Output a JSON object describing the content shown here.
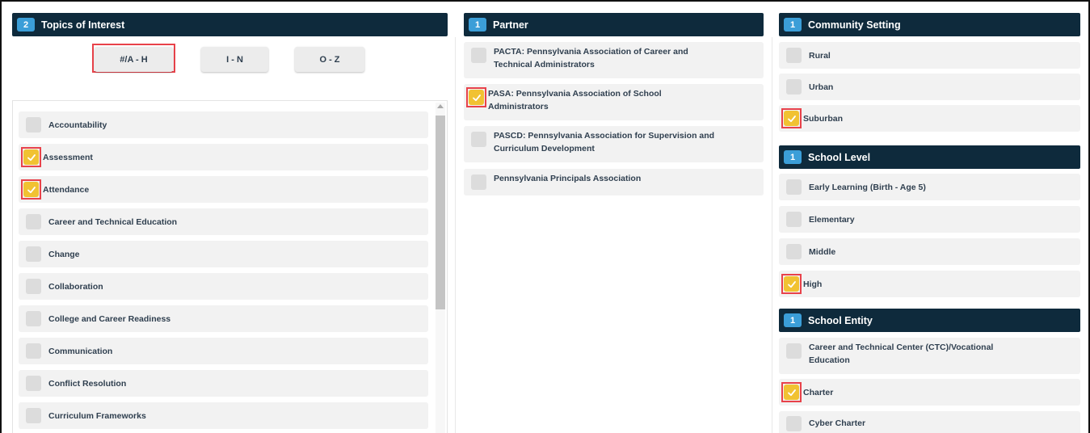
{
  "topics": {
    "count": "2",
    "title": "Topics of Interest",
    "filters": [
      "#/A - H",
      "I - N",
      "O - Z"
    ],
    "items": [
      {
        "label": "Accountability",
        "checked": false
      },
      {
        "label": "Assessment",
        "checked": true
      },
      {
        "label": "Attendance",
        "checked": true
      },
      {
        "label": "Career and Technical Education",
        "checked": false
      },
      {
        "label": "Change",
        "checked": false
      },
      {
        "label": "Collaboration",
        "checked": false
      },
      {
        "label": "College and Career Readiness",
        "checked": false
      },
      {
        "label": "Communication",
        "checked": false
      },
      {
        "label": "Conflict Resolution",
        "checked": false
      },
      {
        "label": "Curriculum Frameworks",
        "checked": false
      }
    ]
  },
  "partner": {
    "count": "1",
    "title": "Partner",
    "items": [
      {
        "label1": "PACTA: Pennsylvania Association of Career and",
        "label2": "Technical Administrators",
        "checked": false
      },
      {
        "label1": "PASA: Pennsylvania Association of School",
        "label2": "Administrators",
        "checked": true
      },
      {
        "label1": "PASCD: Pennsylvania Association for Supervision and",
        "label2": "Curriculum Development",
        "checked": false
      },
      {
        "label1": "Pennsylvania Principals Association",
        "label2": "",
        "checked": false
      }
    ]
  },
  "community": {
    "count": "1",
    "title": "Community Setting",
    "items": [
      {
        "label": "Rural",
        "checked": false
      },
      {
        "label": "Urban",
        "checked": false
      },
      {
        "label": "Suburban",
        "checked": true
      }
    ]
  },
  "school_level": {
    "count": "1",
    "title": "School Level",
    "items": [
      {
        "label": "Early Learning (Birth - Age 5)",
        "checked": false
      },
      {
        "label": "Elementary",
        "checked": false
      },
      {
        "label": "Middle",
        "checked": false
      },
      {
        "label": "High",
        "checked": true
      }
    ]
  },
  "school_entity": {
    "count": "1",
    "title": "School Entity",
    "items": [
      {
        "label1": "Career and Technical Center (CTC)/Vocational",
        "label2": "Education",
        "checked": false
      },
      {
        "label1": "Charter",
        "label2": "",
        "checked": true
      },
      {
        "label1": "Cyber Charter",
        "label2": "",
        "checked": false
      }
    ]
  },
  "colors": {
    "header_bg": "#0e2a3c",
    "badge": "#3b9ed8",
    "checked": "#f1c232",
    "highlight": "#e8424a"
  }
}
